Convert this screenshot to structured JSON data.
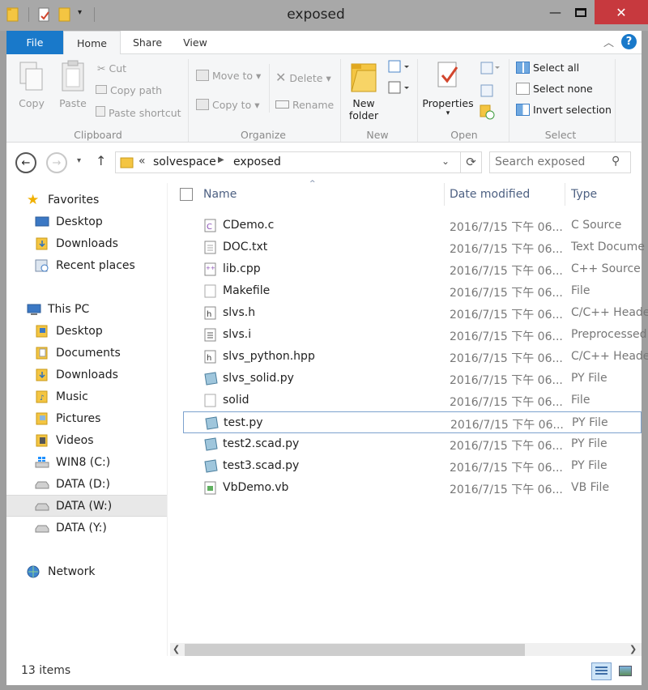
{
  "window": {
    "title": "exposed"
  },
  "colors": {
    "accent": "#1979ca",
    "close": "#c7393e",
    "folder": "#f4c542",
    "selection": "#e5f3fb"
  },
  "ribbon_tabs": [
    "File",
    "Home",
    "Share",
    "View"
  ],
  "ribbon": {
    "clipboard": {
      "label": "Clipboard",
      "copy": "Copy",
      "paste": "Paste",
      "cut": "Cut",
      "copy_path": "Copy path",
      "paste_shortcut": "Paste shortcut"
    },
    "organize": {
      "label": "Organize",
      "move_to": "Move to",
      "copy_to": "Copy to",
      "delete": "Delete",
      "rename": "Rename"
    },
    "new": {
      "label": "New",
      "new_folder_line1": "New",
      "new_folder_line2": "folder"
    },
    "open": {
      "label": "Open",
      "properties": "Properties"
    },
    "select": {
      "label": "Select",
      "select_all": "Select all",
      "select_none": "Select none",
      "invert": "Invert selection"
    }
  },
  "address": {
    "chevron": "«",
    "crumbs": [
      "solvespace",
      "exposed"
    ],
    "search_placeholder": "Search exposed"
  },
  "nav": {
    "favorites": "Favorites",
    "fav_items": [
      "Desktop",
      "Downloads",
      "Recent places"
    ],
    "this_pc": "This PC",
    "pc_items": [
      "Desktop",
      "Documents",
      "Downloads",
      "Music",
      "Pictures",
      "Videos",
      "WIN8 (C:)",
      "DATA (D:)",
      "DATA (W:)",
      "DATA (Y:)"
    ],
    "network": "Network"
  },
  "columns": {
    "name": "Name",
    "date": "Date modified",
    "type": "Type"
  },
  "files": [
    {
      "name": "CDemo.c",
      "date": "2016/7/15 下午 06...",
      "type": "C Source"
    },
    {
      "name": "DOC.txt",
      "date": "2016/7/15 下午 06...",
      "type": "Text Docume"
    },
    {
      "name": "lib.cpp",
      "date": "2016/7/15 下午 06...",
      "type": "C++ Source"
    },
    {
      "name": "Makefile",
      "date": "2016/7/15 下午 06...",
      "type": "File"
    },
    {
      "name": "slvs.h",
      "date": "2016/7/15 下午 06...",
      "type": "C/C++ Heade"
    },
    {
      "name": "slvs.i",
      "date": "2016/7/15 下午 06...",
      "type": "Preprocessed"
    },
    {
      "name": "slvs_python.hpp",
      "date": "2016/7/15 下午 06...",
      "type": "C/C++ Heade"
    },
    {
      "name": "slvs_solid.py",
      "date": "2016/7/15 下午 06...",
      "type": "PY File"
    },
    {
      "name": "solid",
      "date": "2016/7/15 下午 06...",
      "type": "File"
    },
    {
      "name": "test.py",
      "date": "2016/7/15 下午 06...",
      "type": "PY File"
    },
    {
      "name": "test2.scad.py",
      "date": "2016/7/15 下午 06...",
      "type": "PY File"
    },
    {
      "name": "test3.scad.py",
      "date": "2016/7/15 下午 06...",
      "type": "PY File"
    },
    {
      "name": "VbDemo.vb",
      "date": "2016/7/15 下午 06...",
      "type": "VB File"
    }
  ],
  "status": {
    "count": "13 items"
  }
}
